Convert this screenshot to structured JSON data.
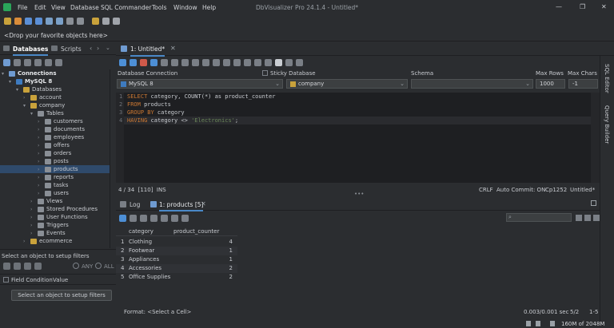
{
  "app": {
    "window_title": "DbVisualizer Pro 24.1.4 - Untitled*",
    "menu": [
      "File",
      "Edit",
      "View",
      "Database",
      "SQL Commander",
      "Tools",
      "Window",
      "Help"
    ]
  },
  "favorites": {
    "placeholder": "<Drop your favorite objects here>"
  },
  "left_panel": {
    "tabs": [
      "Databases",
      "Scripts"
    ],
    "tree": [
      {
        "label": "Connections",
        "level": 0,
        "bold": true,
        "twisty": "▾"
      },
      {
        "label": "MySQL 8",
        "level": 1,
        "bold": true,
        "twisty": "▾"
      },
      {
        "label": "Databases",
        "level": 2,
        "twisty": "▾"
      },
      {
        "label": "account",
        "level": 3,
        "twisty": "›"
      },
      {
        "label": "company",
        "level": 3,
        "twisty": "▾"
      },
      {
        "label": "Tables",
        "level": 4,
        "twisty": "▾"
      },
      {
        "label": "customers",
        "level": 5,
        "twisty": "›"
      },
      {
        "label": "documents",
        "level": 5,
        "twisty": "›"
      },
      {
        "label": "employees",
        "level": 5,
        "twisty": "›"
      },
      {
        "label": "offers",
        "level": 5,
        "twisty": "›"
      },
      {
        "label": "orders",
        "level": 5,
        "twisty": "›"
      },
      {
        "label": "posts",
        "level": 5,
        "twisty": "›"
      },
      {
        "label": "products",
        "level": 5,
        "twisty": "›",
        "selected": true
      },
      {
        "label": "reports",
        "level": 5,
        "twisty": "›"
      },
      {
        "label": "tasks",
        "level": 5,
        "twisty": "›"
      },
      {
        "label": "users",
        "level": 5,
        "twisty": "›"
      },
      {
        "label": "Views",
        "level": 4,
        "twisty": "›"
      },
      {
        "label": "Stored Procedures",
        "level": 4,
        "twisty": "›"
      },
      {
        "label": "User Functions",
        "level": 4,
        "twisty": "›"
      },
      {
        "label": "Triggers",
        "level": 4,
        "twisty": "›"
      },
      {
        "label": "Events",
        "level": 4,
        "twisty": "›"
      },
      {
        "label": "ecommerce",
        "level": 3,
        "twisty": "›"
      }
    ],
    "filter": {
      "hint": "Select an object to setup filters",
      "any_label": "ANY",
      "all_label": "ALL",
      "field_condition_label": "Field Condition",
      "value_label": "Value",
      "button": "Select an object to setup filters"
    }
  },
  "editor": {
    "tab_label": "1: Untitled*",
    "labels": {
      "connection": "Database Connection",
      "sticky": "Sticky Database",
      "schema": "Schema",
      "max_rows": "Max Rows",
      "max_chars": "Max Chars"
    },
    "values": {
      "connection": "MySQL 8",
      "database": "company",
      "schema": "",
      "max_rows": "1000",
      "max_chars": "-1"
    },
    "code": [
      [
        {
          "t": "SELECT",
          "k": "kw"
        },
        {
          "t": " category, COUNT(*) as product_counter"
        }
      ],
      [
        {
          "t": "FROM",
          "k": "kw"
        },
        {
          "t": " products"
        }
      ],
      [
        {
          "t": "GROUP BY",
          "k": "kw"
        },
        {
          "t": " category"
        }
      ],
      [
        {
          "t": "HAVING",
          "k": "kw"
        },
        {
          "t": " category <> "
        },
        {
          "t": "'Electronics'",
          "k": "str"
        },
        {
          "t": ";"
        }
      ]
    ],
    "status_left": "4 / 34  [110]  INS",
    "status_right": [
      "CRLF",
      "Auto Commit: ON",
      "Cp1252",
      "Untitled*"
    ],
    "side_tabs": [
      "SQL Editor",
      "Query Builder"
    ]
  },
  "results": {
    "tabs": [
      "Log",
      "1: products [5]"
    ],
    "columns": [
      "category",
      "product_counter"
    ],
    "rows": [
      [
        "Clothing",
        "4"
      ],
      [
        "Footwear",
        "1"
      ],
      [
        "Appliances",
        "1"
      ],
      [
        "Accessories",
        "2"
      ],
      [
        "Office Supplies",
        "2"
      ]
    ],
    "format_text": "Format: <Select a Cell>",
    "timing": "0.003/0.001 sec",
    "page": "5/2",
    "range": "1-5",
    "memory": "160M of 2048M"
  }
}
